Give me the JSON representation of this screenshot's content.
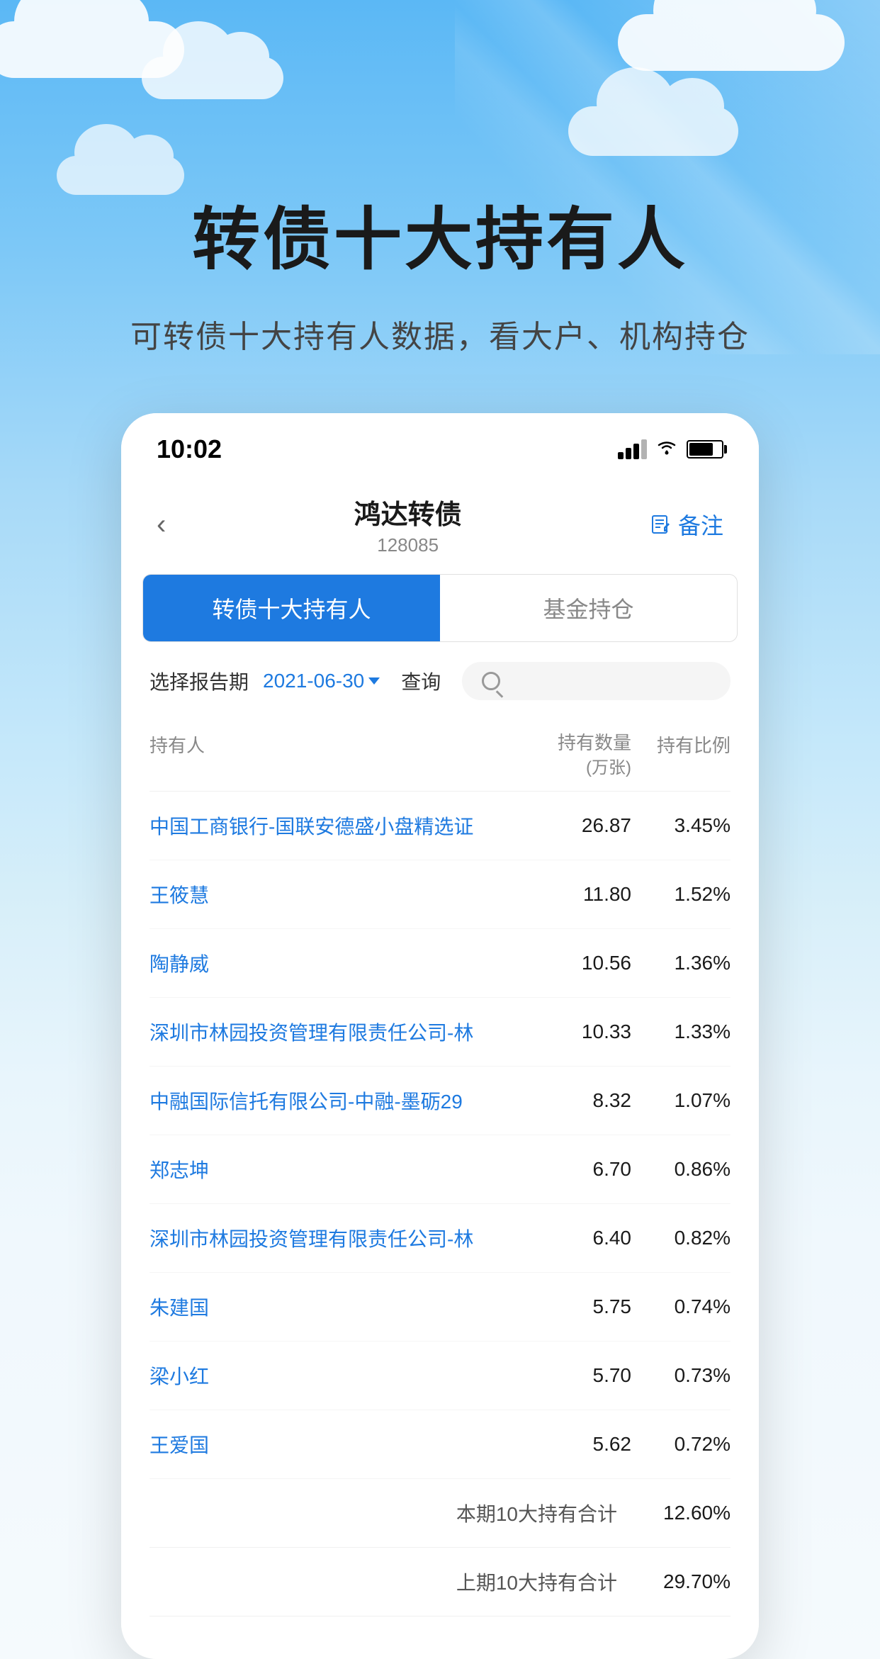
{
  "hero": {
    "title": "转债十大持有人",
    "subtitle": "可转债十大持有人数据，看大户、机构持仓"
  },
  "status_bar": {
    "time": "10:02",
    "signal": "signal",
    "wifi": "wifi",
    "battery": "battery"
  },
  "nav": {
    "back_label": "‹",
    "title": "鸿达转债",
    "code": "128085",
    "note_label": "备注"
  },
  "tabs": [
    {
      "label": "转债十大持有人",
      "active": true
    },
    {
      "label": "基金持仓",
      "active": false
    }
  ],
  "filter": {
    "label": "选择报告期",
    "date": "2021-06-30",
    "query_label": "查询",
    "search_placeholder": ""
  },
  "table": {
    "headers": {
      "name": "持有人",
      "qty": "持有数量\n(万张)",
      "ratio": "持有比例"
    },
    "rows": [
      {
        "name": "中国工商银行-国联安德盛小盘精选证",
        "qty": "26.87",
        "ratio": "3.45%"
      },
      {
        "name": "王筱慧",
        "qty": "11.80",
        "ratio": "1.52%"
      },
      {
        "name": "陶静威",
        "qty": "10.56",
        "ratio": "1.36%"
      },
      {
        "name": "深圳市林园投资管理有限责任公司-林",
        "qty": "10.33",
        "ratio": "1.33%"
      },
      {
        "name": "中融国际信托有限公司-中融-墨砺29",
        "qty": "8.32",
        "ratio": "1.07%"
      },
      {
        "name": "郑志坤",
        "qty": "6.70",
        "ratio": "0.86%"
      },
      {
        "name": "深圳市林园投资管理有限责任公司-林",
        "qty": "6.40",
        "ratio": "0.82%"
      },
      {
        "name": "朱建国",
        "qty": "5.75",
        "ratio": "0.74%"
      },
      {
        "name": "梁小红",
        "qty": "5.70",
        "ratio": "0.73%"
      },
      {
        "name": "王爱国",
        "qty": "5.62",
        "ratio": "0.72%"
      }
    ],
    "summary": [
      {
        "label": "本期10大持有合计",
        "value": "12.60%"
      },
      {
        "label": "上期10大持有合计",
        "value": "29.70%"
      }
    ]
  },
  "colors": {
    "primary": "#1E7AE0",
    "text_dark": "#1a1a1a",
    "text_muted": "#888",
    "border": "#f0f0f0",
    "tab_bg": "#1E7AE0"
  }
}
